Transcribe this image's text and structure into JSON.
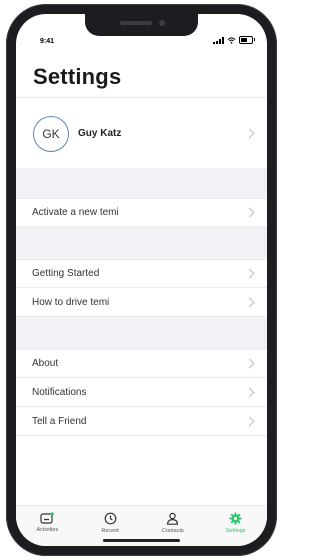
{
  "status_bar": {
    "time": "9:41"
  },
  "header": {
    "title": "Settings"
  },
  "profile": {
    "initials": "GK",
    "name": "Guy Katz"
  },
  "sections": [
    {
      "items": [
        {
          "label": "Activate a new temi"
        }
      ]
    },
    {
      "items": [
        {
          "label": "Getting Started"
        },
        {
          "label": "How to drive temi"
        }
      ]
    },
    {
      "items": [
        {
          "label": "About"
        },
        {
          "label": "Notifications"
        },
        {
          "label": "Tell a Friend"
        }
      ]
    }
  ],
  "tabs": [
    {
      "label": "Activities",
      "icon": "activities-icon",
      "active": false
    },
    {
      "label": "Recent",
      "icon": "clock-icon",
      "active": false
    },
    {
      "label": "Contacts",
      "icon": "person-icon",
      "active": false
    },
    {
      "label": "Settings",
      "icon": "gear-icon",
      "active": true
    }
  ],
  "colors": {
    "accent": "#2fc76d",
    "avatar_border": "#5b86b8",
    "section_gap": "#f2f2f6"
  }
}
